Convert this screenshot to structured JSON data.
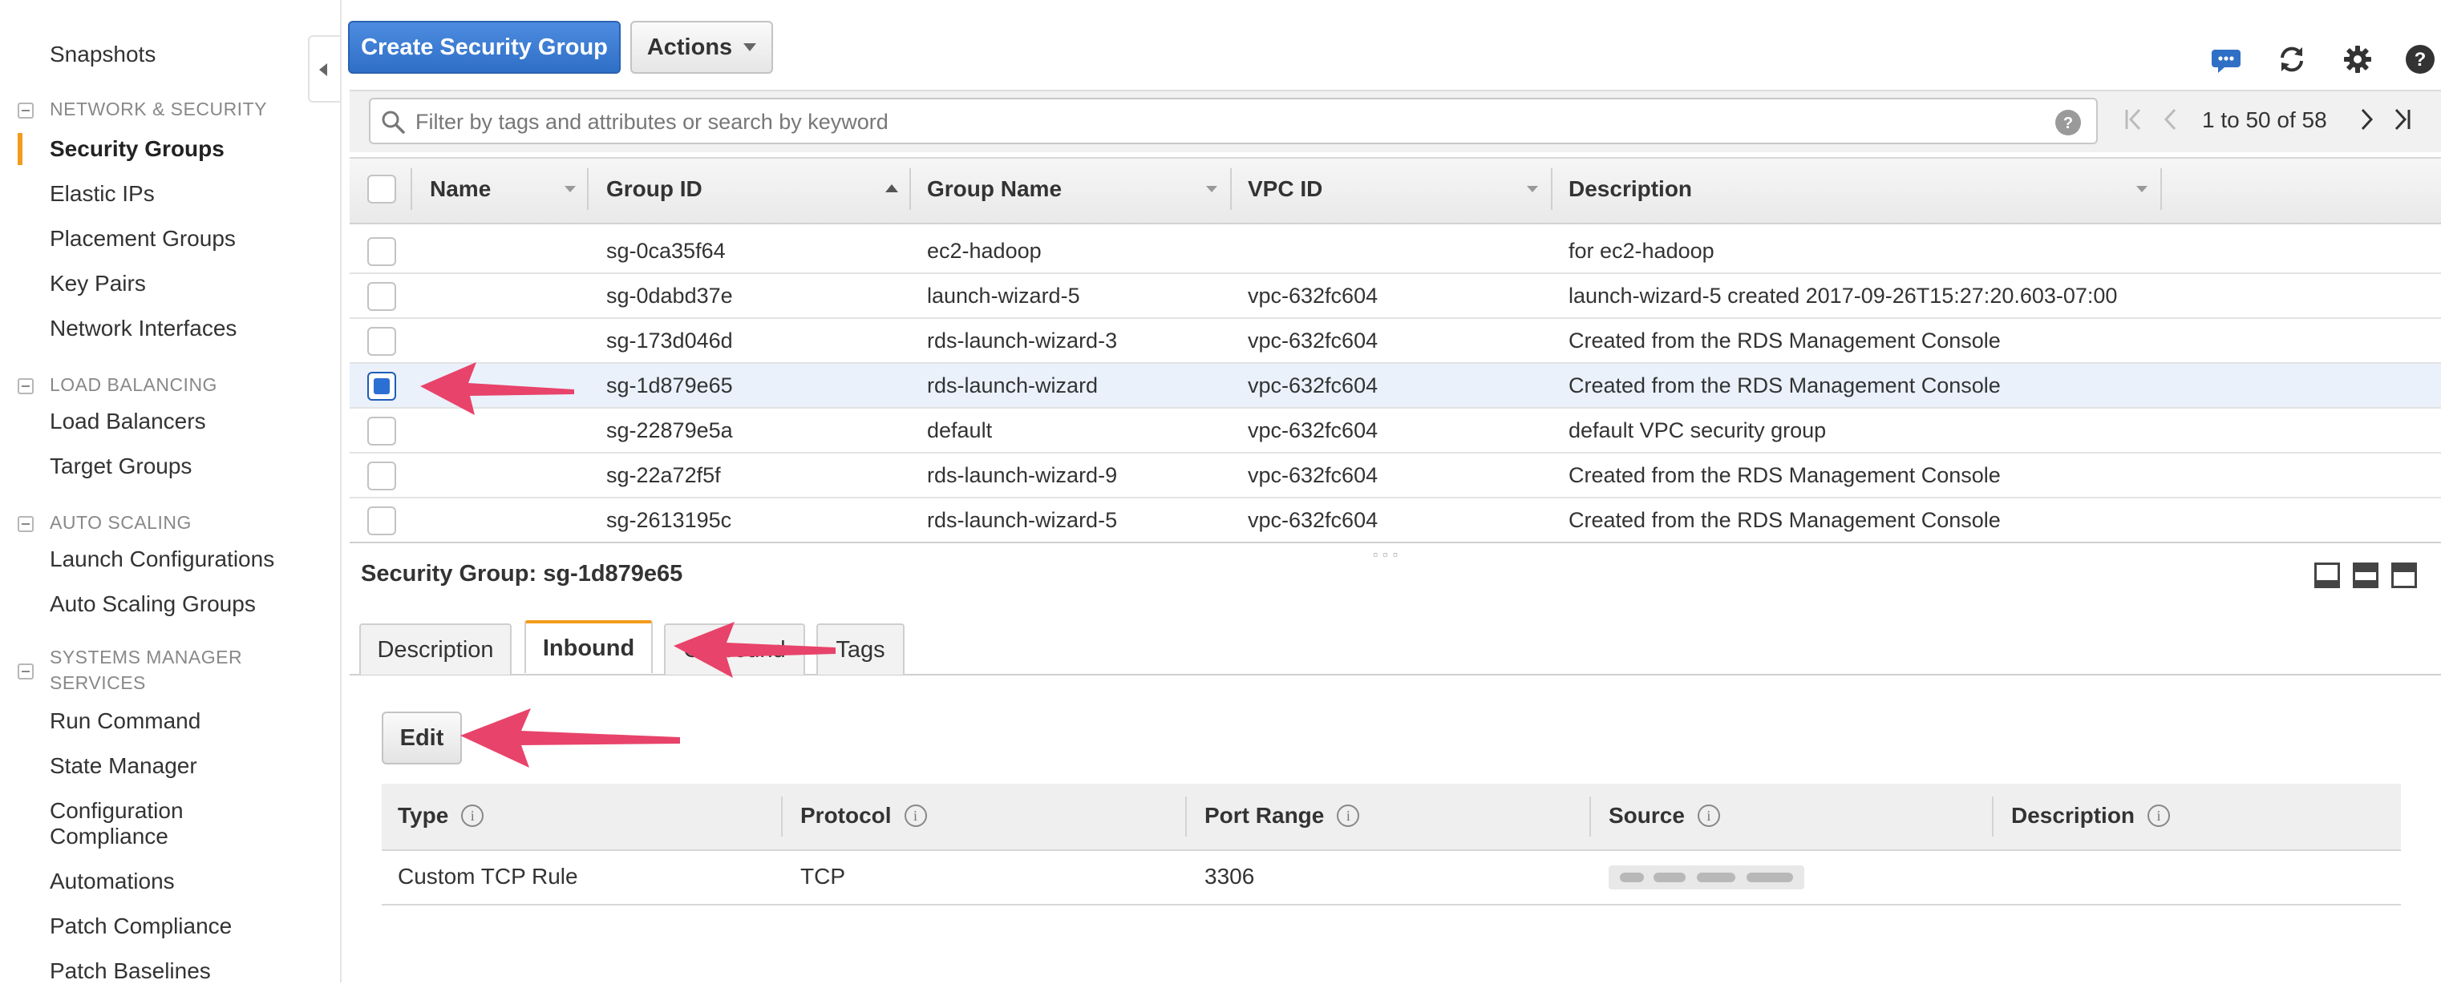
{
  "sidebar": {
    "items": [
      {
        "label": "Snapshots"
      },
      {
        "label": "Security Groups"
      },
      {
        "label": "Elastic IPs"
      },
      {
        "label": "Placement Groups"
      },
      {
        "label": "Key Pairs"
      },
      {
        "label": "Network Interfaces"
      },
      {
        "label": "Load Balancers"
      },
      {
        "label": "Target Groups"
      },
      {
        "label": "Launch Configurations"
      },
      {
        "label": "Auto Scaling Groups"
      },
      {
        "label": "Run Command"
      },
      {
        "label": "State Manager"
      },
      {
        "label": "Configuration Compliance"
      },
      {
        "label": "Automations"
      },
      {
        "label": "Patch Compliance"
      },
      {
        "label": "Patch Baselines"
      }
    ],
    "sections": [
      {
        "label": "NETWORK & SECURITY"
      },
      {
        "label": "LOAD BALANCING"
      },
      {
        "label": "AUTO SCALING"
      },
      {
        "label": "SYSTEMS MANAGER SERVICES"
      }
    ],
    "active_item": "Security Groups"
  },
  "toolbar": {
    "create_label": "Create Security Group",
    "actions_label": "Actions"
  },
  "filter": {
    "placeholder": "Filter by tags and attributes or search by keyword",
    "pager_text": "1 to 50 of 58"
  },
  "grid": {
    "columns": [
      "Name",
      "Group ID",
      "Group Name",
      "VPC ID",
      "Description"
    ],
    "rows": [
      {
        "name": "",
        "group_id": "sg-0ca35f64",
        "group_name": "ec2-hadoop",
        "vpc_id": "",
        "description": "for ec2-hadoop",
        "selected": false
      },
      {
        "name": "",
        "group_id": "sg-0dabd37e",
        "group_name": "launch-wizard-5",
        "vpc_id": "vpc-632fc604",
        "description": "launch-wizard-5 created 2017-09-26T15:27:20.603-07:00",
        "selected": false
      },
      {
        "name": "",
        "group_id": "sg-173d046d",
        "group_name": "rds-launch-wizard-3",
        "vpc_id": "vpc-632fc604",
        "description": "Created from the RDS Management Console",
        "selected": false
      },
      {
        "name": "",
        "group_id": "sg-1d879e65",
        "group_name": "rds-launch-wizard",
        "vpc_id": "vpc-632fc604",
        "description": "Created from the RDS Management Console",
        "selected": true
      },
      {
        "name": "",
        "group_id": "sg-22879e5a",
        "group_name": "default",
        "vpc_id": "vpc-632fc604",
        "description": "default VPC security group",
        "selected": false
      },
      {
        "name": "",
        "group_id": "sg-22a72f5f",
        "group_name": "rds-launch-wizard-9",
        "vpc_id": "vpc-632fc604",
        "description": "Created from the RDS Management Console",
        "selected": false
      },
      {
        "name": "",
        "group_id": "sg-2613195c",
        "group_name": "rds-launch-wizard-5",
        "vpc_id": "vpc-632fc604",
        "description": "Created from the RDS Management Console",
        "selected": false
      }
    ]
  },
  "details": {
    "title": "Security Group: sg-1d879e65",
    "tabs": [
      {
        "label": "Description"
      },
      {
        "label": "Inbound"
      },
      {
        "label": "Outbound"
      },
      {
        "label": "Tags"
      }
    ],
    "active_tab": "Inbound",
    "edit_label": "Edit",
    "rule_columns": [
      "Type",
      "Protocol",
      "Port Range",
      "Source",
      "Description"
    ],
    "rules": [
      {
        "type": "Custom TCP Rule",
        "protocol": "TCP",
        "port_range": "3306",
        "source": "",
        "description": ""
      }
    ]
  },
  "colors": {
    "accent_orange": "#f29b1c",
    "primary_blue": "#2f6fc6",
    "annotation_pink": "#e8436a",
    "selected_row": "#eaf1fb"
  },
  "icons": [
    "chat-icon",
    "refresh-icon",
    "gear-icon",
    "help-icon",
    "search-icon",
    "first-page-icon",
    "prev-page-icon",
    "next-page-icon",
    "last-page-icon"
  ]
}
